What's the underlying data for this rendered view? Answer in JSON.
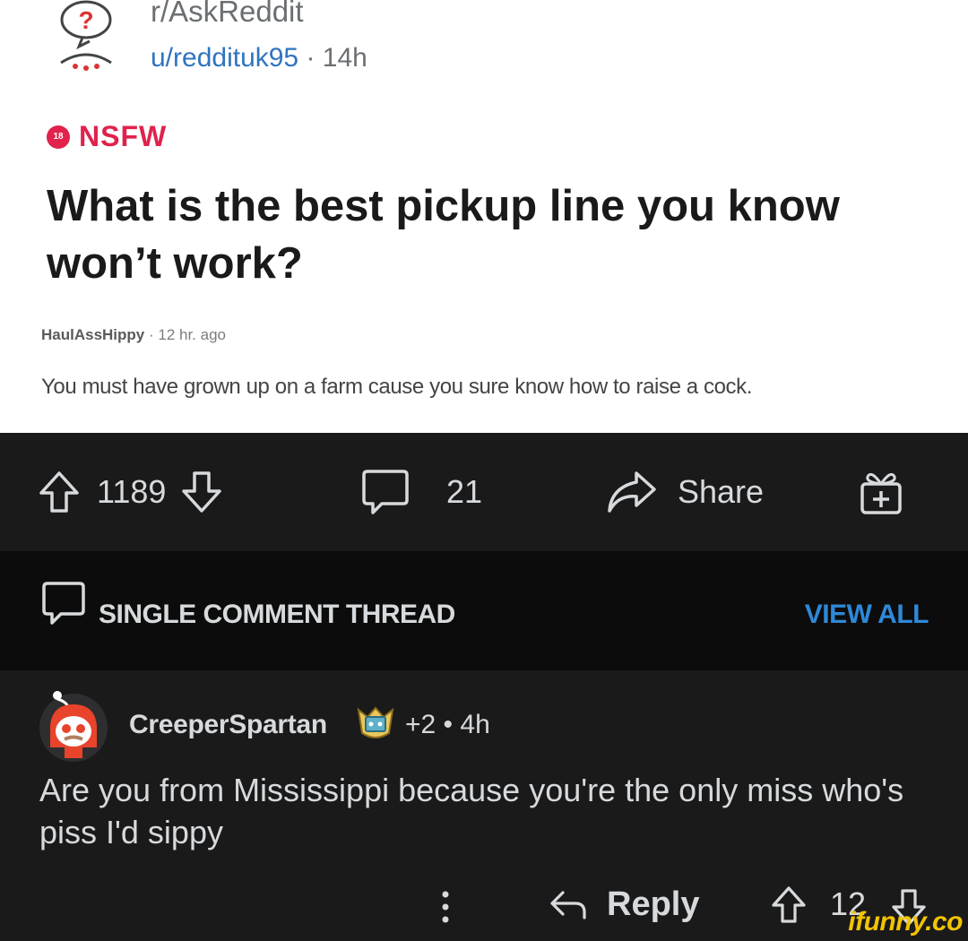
{
  "post": {
    "subreddit": "r/AskReddit",
    "author": "u/reddituk95",
    "separator": " · ",
    "age": "14h",
    "nsfw_label": "NSFW",
    "nsfw_badge": "18",
    "title": "What is the best pickup line you know won’t work?",
    "embedded_comment": {
      "author": "HaulAssHippy",
      "separator": " · ",
      "age": "12 hr. ago",
      "body": "You must have grown up on a farm cause you sure know how to raise a cock."
    }
  },
  "action_bar": {
    "score": "1189",
    "comments": "21",
    "share_label": "Share"
  },
  "thread_header": {
    "label": "SINGLE COMMENT THREAD",
    "view_all": "VIEW ALL"
  },
  "comment": {
    "author": "CreeperSpartan",
    "award_count": "+2",
    "separator": " • ",
    "age": "4h",
    "body": "Are you from Mississippi because you're the only miss who's piss I'd sippy",
    "reply_label": "Reply",
    "score": "12"
  },
  "watermark": "ifunny.co",
  "colors": {
    "nsfw": "#e0224c",
    "link_blue": "#2f88d8",
    "dark_bg": "#1a1a1b",
    "header_bg": "#0c0c0c",
    "watermark": "#f3c300"
  }
}
